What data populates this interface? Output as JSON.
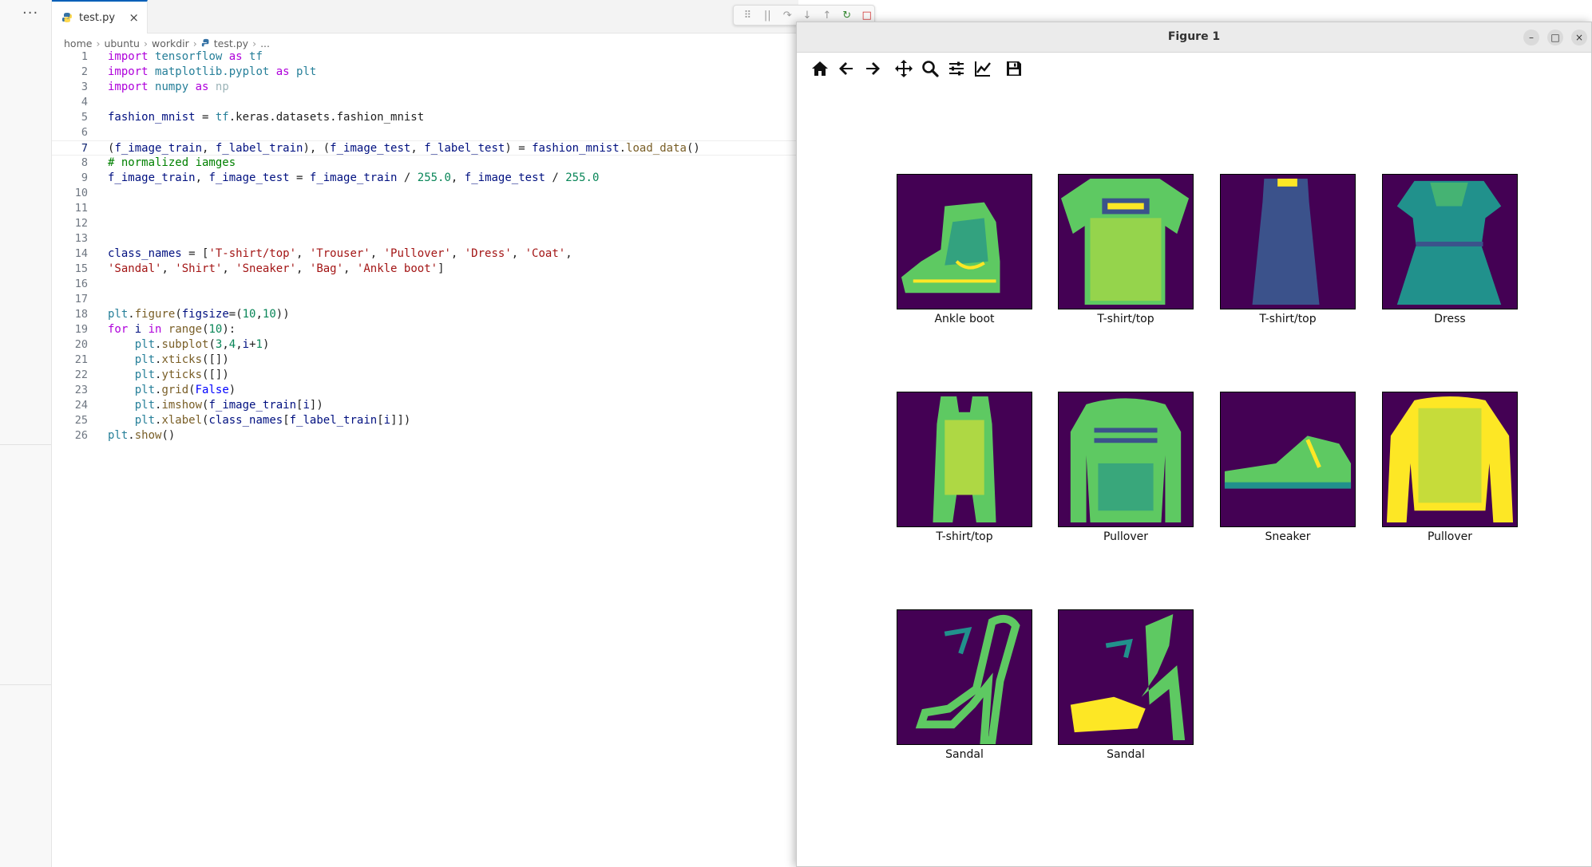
{
  "sidebar": {
    "more_label": "···"
  },
  "editor": {
    "tab": {
      "label": "test.py",
      "close": "×"
    },
    "breadcrumb": [
      "home",
      "ubuntu",
      "workdir",
      "test.py",
      "..."
    ],
    "debug_toolbar": [
      "⠿",
      "||",
      "↷",
      "↓",
      "↑",
      "↻",
      "□"
    ]
  },
  "code_lines": [
    {
      "n": "1",
      "tokens": [
        [
          "kw",
          "import"
        ],
        [
          "plain",
          " "
        ],
        [
          "mod",
          "tensorflow"
        ],
        [
          "plain",
          " "
        ],
        [
          "kw",
          "as"
        ],
        [
          "plain",
          " "
        ],
        [
          "mod",
          "tf"
        ]
      ]
    },
    {
      "n": "2",
      "tokens": [
        [
          "kw",
          "import"
        ],
        [
          "plain",
          " "
        ],
        [
          "mod",
          "matplotlib.pyplot"
        ],
        [
          "plain",
          " "
        ],
        [
          "kw",
          "as"
        ],
        [
          "plain",
          " "
        ],
        [
          "mod",
          "plt"
        ]
      ]
    },
    {
      "n": "3",
      "tokens": [
        [
          "kw",
          "import"
        ],
        [
          "plain",
          " "
        ],
        [
          "mod",
          "numpy"
        ],
        [
          "plain",
          " "
        ],
        [
          "kw",
          "as"
        ],
        [
          "plain",
          " "
        ],
        [
          "dim",
          "np"
        ]
      ]
    },
    {
      "n": "4",
      "tokens": []
    },
    {
      "n": "5",
      "tokens": [
        [
          "var",
          "fashion_mnist"
        ],
        [
          "plain",
          " = "
        ],
        [
          "mod",
          "tf"
        ],
        [
          "plain",
          ".keras.datasets.fashion_mnist"
        ]
      ]
    },
    {
      "n": "6",
      "tokens": []
    },
    {
      "n": "7",
      "active": true,
      "tokens": [
        [
          "plain",
          "("
        ],
        [
          "var",
          "f_image_train"
        ],
        [
          "plain",
          ", "
        ],
        [
          "var",
          "f_label_train"
        ],
        [
          "plain",
          "), ("
        ],
        [
          "var",
          "f_image_test"
        ],
        [
          "plain",
          ", "
        ],
        [
          "var",
          "f_label_test"
        ],
        [
          "plain",
          ") = "
        ],
        [
          "var",
          "fashion_mnist"
        ],
        [
          "plain",
          "."
        ],
        [
          "fn",
          "load_data"
        ],
        [
          "plain",
          "()"
        ]
      ]
    },
    {
      "n": "8",
      "tokens": [
        [
          "cmt",
          "# normalized iamges"
        ]
      ]
    },
    {
      "n": "9",
      "tokens": [
        [
          "var",
          "f_image_train"
        ],
        [
          "plain",
          ", "
        ],
        [
          "var",
          "f_image_test"
        ],
        [
          "plain",
          " = "
        ],
        [
          "var",
          "f_image_train"
        ],
        [
          "plain",
          " / "
        ],
        [
          "num",
          "255.0"
        ],
        [
          "plain",
          ", "
        ],
        [
          "var",
          "f_image_test"
        ],
        [
          "plain",
          " / "
        ],
        [
          "num",
          "255.0"
        ]
      ]
    },
    {
      "n": "10",
      "tokens": []
    },
    {
      "n": "11",
      "tokens": []
    },
    {
      "n": "12",
      "tokens": []
    },
    {
      "n": "13",
      "tokens": []
    },
    {
      "n": "14",
      "tokens": [
        [
          "var",
          "class_names"
        ],
        [
          "plain",
          " = ["
        ],
        [
          "str",
          "'T-shirt/top'"
        ],
        [
          "plain",
          ", "
        ],
        [
          "str",
          "'Trouser'"
        ],
        [
          "plain",
          ", "
        ],
        [
          "str",
          "'Pullover'"
        ],
        [
          "plain",
          ", "
        ],
        [
          "str",
          "'Dress'"
        ],
        [
          "plain",
          ", "
        ],
        [
          "str",
          "'Coat'"
        ],
        [
          "plain",
          ","
        ]
      ]
    },
    {
      "n": "15",
      "tokens": [
        [
          "str",
          "'Sandal'"
        ],
        [
          "plain",
          ", "
        ],
        [
          "str",
          "'Shirt'"
        ],
        [
          "plain",
          ", "
        ],
        [
          "str",
          "'Sneaker'"
        ],
        [
          "plain",
          ", "
        ],
        [
          "str",
          "'Bag'"
        ],
        [
          "plain",
          ", "
        ],
        [
          "str",
          "'Ankle boot'"
        ],
        [
          "plain",
          "]"
        ]
      ]
    },
    {
      "n": "16",
      "tokens": []
    },
    {
      "n": "17",
      "tokens": []
    },
    {
      "n": "18",
      "tokens": [
        [
          "mod",
          "plt"
        ],
        [
          "plain",
          "."
        ],
        [
          "fn",
          "figure"
        ],
        [
          "plain",
          "("
        ],
        [
          "var",
          "figsize"
        ],
        [
          "plain",
          "=("
        ],
        [
          "num",
          "10"
        ],
        [
          "plain",
          ","
        ],
        [
          "num",
          "10"
        ],
        [
          "plain",
          "))"
        ]
      ]
    },
    {
      "n": "19",
      "tokens": [
        [
          "ctl",
          "for"
        ],
        [
          "plain",
          " "
        ],
        [
          "var",
          "i"
        ],
        [
          "plain",
          " "
        ],
        [
          "ctl",
          "in"
        ],
        [
          "plain",
          " "
        ],
        [
          "fn",
          "range"
        ],
        [
          "plain",
          "("
        ],
        [
          "num",
          "10"
        ],
        [
          "plain",
          "):"
        ]
      ]
    },
    {
      "n": "20",
      "tokens": [
        [
          "plain",
          "    "
        ],
        [
          "mod",
          "plt"
        ],
        [
          "plain",
          "."
        ],
        [
          "fn",
          "subplot"
        ],
        [
          "plain",
          "("
        ],
        [
          "num",
          "3"
        ],
        [
          "plain",
          ","
        ],
        [
          "num",
          "4"
        ],
        [
          "plain",
          ","
        ],
        [
          "var",
          "i"
        ],
        [
          "plain",
          "+"
        ],
        [
          "num",
          "1"
        ],
        [
          "plain",
          ")"
        ]
      ]
    },
    {
      "n": "21",
      "tokens": [
        [
          "plain",
          "    "
        ],
        [
          "mod",
          "plt"
        ],
        [
          "plain",
          "."
        ],
        [
          "fn",
          "xticks"
        ],
        [
          "plain",
          "([])"
        ]
      ]
    },
    {
      "n": "22",
      "tokens": [
        [
          "plain",
          "    "
        ],
        [
          "mod",
          "plt"
        ],
        [
          "plain",
          "."
        ],
        [
          "fn",
          "yticks"
        ],
        [
          "plain",
          "([])"
        ]
      ]
    },
    {
      "n": "23",
      "tokens": [
        [
          "plain",
          "    "
        ],
        [
          "mod",
          "plt"
        ],
        [
          "plain",
          "."
        ],
        [
          "fn",
          "grid"
        ],
        [
          "plain",
          "("
        ],
        [
          "bool",
          "False"
        ],
        [
          "plain",
          ")"
        ]
      ]
    },
    {
      "n": "24",
      "tokens": [
        [
          "plain",
          "    "
        ],
        [
          "mod",
          "plt"
        ],
        [
          "plain",
          "."
        ],
        [
          "fn",
          "imshow"
        ],
        [
          "plain",
          "("
        ],
        [
          "var",
          "f_image_train"
        ],
        [
          "plain",
          "["
        ],
        [
          "var",
          "i"
        ],
        [
          "plain",
          "])"
        ]
      ]
    },
    {
      "n": "25",
      "tokens": [
        [
          "plain",
          "    "
        ],
        [
          "mod",
          "plt"
        ],
        [
          "plain",
          "."
        ],
        [
          "fn",
          "xlabel"
        ],
        [
          "plain",
          "("
        ],
        [
          "var",
          "class_names"
        ],
        [
          "plain",
          "["
        ],
        [
          "var",
          "f_label_train"
        ],
        [
          "plain",
          "["
        ],
        [
          "var",
          "i"
        ],
        [
          "plain",
          "]])"
        ]
      ]
    },
    {
      "n": "26",
      "tokens": [
        [
          "mod",
          "plt"
        ],
        [
          "plain",
          "."
        ],
        [
          "fn",
          "show"
        ],
        [
          "plain",
          "()"
        ]
      ]
    }
  ],
  "figure": {
    "title": "Figure 1",
    "toolbar": [
      "home-icon",
      "back-icon",
      "forward-icon",
      "pan-icon",
      "zoom-icon",
      "configure-subplots-icon",
      "edit-axis-icon",
      "save-icon"
    ],
    "window_buttons": [
      "–",
      "□",
      "×"
    ],
    "subplot_labels": [
      "Ankle boot",
      "T-shirt/top",
      "T-shirt/top",
      "Dress",
      "T-shirt/top",
      "Pullover",
      "Sneaker",
      "Pullover",
      "Sandal",
      "Sandal"
    ],
    "colors": {
      "background": "#440154",
      "teal": "#21918c",
      "green": "#5ec962",
      "yellow": "#fde725",
      "blue": "#3b528b"
    }
  }
}
